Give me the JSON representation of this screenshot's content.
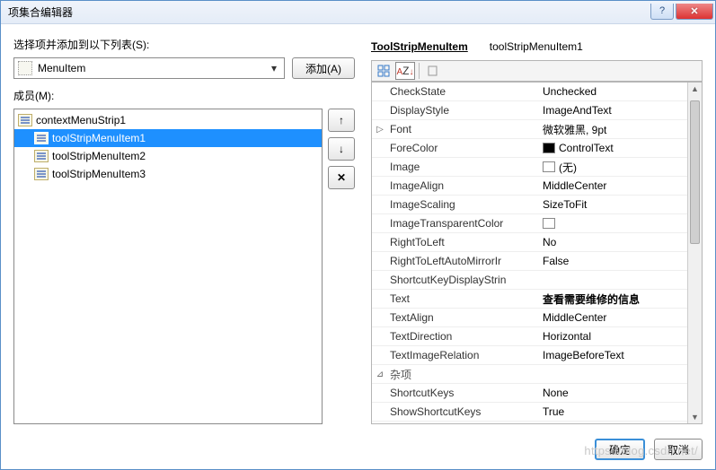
{
  "window": {
    "title": "项集合编辑器"
  },
  "left": {
    "selectLabel": "选择项并添加到以下列表(S):",
    "typeCombo": "MenuItem",
    "addBtn": "添加(A)",
    "membersLabel": "成员(M):",
    "tree": {
      "root": "contextMenuStrip1",
      "items": [
        "toolStripMenuItem1",
        "toolStripMenuItem2",
        "toolStripMenuItem3"
      ],
      "selectedIndex": 0
    },
    "sideButtons": {
      "up": "✦",
      "down": "✦",
      "del": "✕"
    }
  },
  "right": {
    "typeName": "ToolStripMenuItem",
    "instanceName": "toolStripMenuItem1",
    "props": [
      {
        "exp": "",
        "name": "CheckState",
        "value": "Unchecked"
      },
      {
        "exp": "",
        "name": "DisplayStyle",
        "value": "ImageAndText"
      },
      {
        "exp": "▷",
        "name": "Font",
        "value": "微软雅黑, 9pt"
      },
      {
        "exp": "",
        "name": "ForeColor",
        "value": "ControlText",
        "swatch": "black"
      },
      {
        "exp": "",
        "name": "Image",
        "value": "(无)",
        "swatch": "white"
      },
      {
        "exp": "",
        "name": "ImageAlign",
        "value": "MiddleCenter"
      },
      {
        "exp": "",
        "name": "ImageScaling",
        "value": "SizeToFit"
      },
      {
        "exp": "",
        "name": "ImageTransparentColor",
        "value": "",
        "swatch": "white"
      },
      {
        "exp": "",
        "name": "RightToLeft",
        "value": "No"
      },
      {
        "exp": "",
        "name": "RightToLeftAutoMirrorIr",
        "value": "False"
      },
      {
        "exp": "",
        "name": "ShortcutKeyDisplayStrin",
        "value": ""
      },
      {
        "exp": "",
        "name": "Text",
        "value": "查看需要维修的信息",
        "bold": true
      },
      {
        "exp": "",
        "name": "TextAlign",
        "value": "MiddleCenter"
      },
      {
        "exp": "",
        "name": "TextDirection",
        "value": "Horizontal"
      },
      {
        "exp": "",
        "name": "TextImageRelation",
        "value": "ImageBeforeText"
      },
      {
        "exp": "⊿",
        "name": "杂项",
        "value": "",
        "cat": true
      },
      {
        "exp": "",
        "name": "ShortcutKeys",
        "value": "None"
      },
      {
        "exp": "",
        "name": "ShowShortcutKeys",
        "value": "True"
      }
    ]
  },
  "footer": {
    "ok": "确定",
    "cancel": "取消"
  },
  "watermark": "https://blog.csdn.net/"
}
